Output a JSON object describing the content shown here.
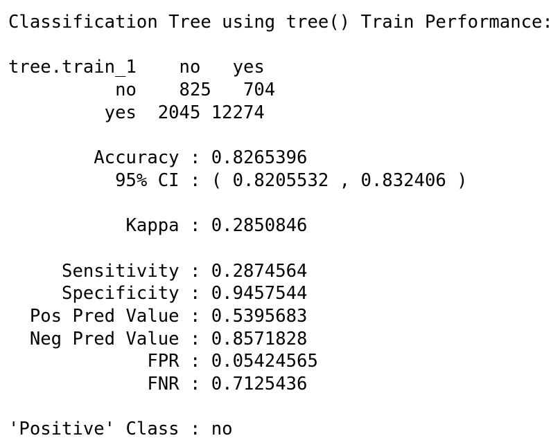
{
  "title": "Classification Tree using tree() Train Performance:",
  "confusion_matrix": {
    "header": "tree.train_1    no   yes",
    "rows": [
      "          no    825   704",
      "         yes  2045 12274"
    ]
  },
  "stats": {
    "accuracy": "        Accuracy : 0.8265396",
    "ci": "          95% CI : ( 0.8205532 , 0.832406 )",
    "kappa": "           Kappa : 0.2850846",
    "sensitivity": "     Sensitivity : 0.2874564",
    "specificity": "     Specificity : 0.9457544",
    "pos_pred_value": "  Pos Pred Value : 0.5395683",
    "neg_pred_value": "  Neg Pred Value : 0.8571828",
    "fpr": "             FPR : 0.05424565",
    "fnr": "             FNR : 0.7125436"
  },
  "positive_class": "'Positive' Class : no"
}
